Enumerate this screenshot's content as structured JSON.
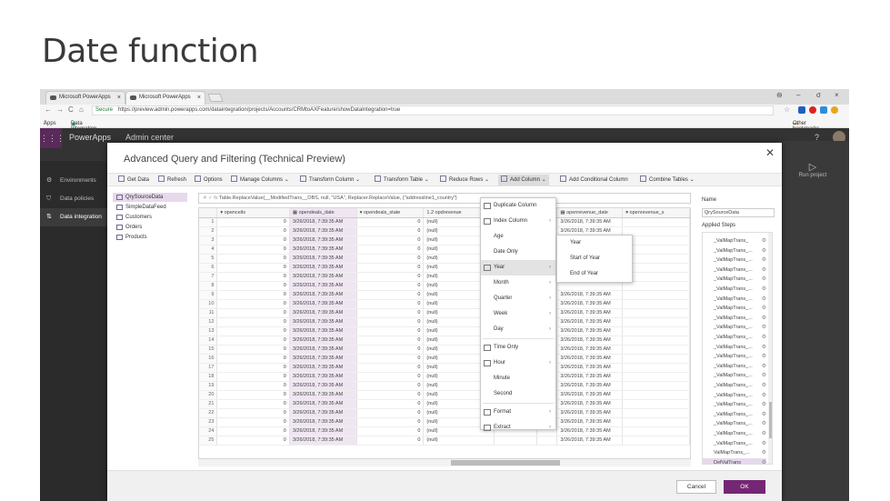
{
  "slide_title": "Date function",
  "browser": {
    "tabs": [
      {
        "label": "Microsoft PowerApps"
      },
      {
        "label": "Microsoft PowerApps"
      }
    ],
    "url_secure": "Secure",
    "url": "https://preview.admin.powerapps.com/dataintegration/projects/Accounts/CRMtoAXFeature/showDataIntegration=true",
    "bookmarks": {
      "apps": "Apps",
      "item": "Data Integration Lab",
      "other": "Other bookmarks"
    }
  },
  "app": {
    "name": "PowerApps",
    "admin": "Admin center",
    "nav": [
      {
        "label": "Environments",
        "icon": "globe-icon"
      },
      {
        "label": "Data policies",
        "icon": "shield-icon"
      },
      {
        "label": "Data integration",
        "icon": "flow-icon"
      }
    ],
    "run_project": "Run project"
  },
  "dialog": {
    "title": "Advanced Query and Filtering (Technical Preview)",
    "ribbon": [
      "Get Data",
      "Refresh",
      "Options",
      "Manage Columns",
      "Transform Column",
      "Transform Table",
      "Reduce Rows",
      "Add Column",
      "Add Conditional Column",
      "Combine Tables"
    ],
    "queries": [
      "QrySourceData",
      "SimpleDataFeed",
      "Customers",
      "Orders",
      "Products"
    ],
    "formula": "Table.ReplaceValue(__ModifiedTrans__OBS, null, \"USA\", Replacer.ReplaceValue, {\"addressline1_country\"}",
    "columns": [
      "openceils",
      "opendeals_date",
      "opendeals_state",
      "opdrevenue",
      "",
      "base",
      "openrevenue_date",
      "openrevenue_s"
    ],
    "rows": [
      {
        "n": "1",
        "a": "0",
        "d": "3/26/2018, 7:39:35 AM",
        "s": "0",
        "v": "(null)",
        "r": "3/26/2018, 7:39:35 AM"
      },
      {
        "n": "2",
        "a": "0",
        "d": "3/26/2018, 7:39:35 AM",
        "s": "0",
        "v": "(null)",
        "r": "3/26/2018, 7:39:35 AM"
      },
      {
        "n": "3",
        "a": "0",
        "d": "3/26/2018, 7:39:35 AM",
        "s": "0",
        "v": "(null)",
        "r": "3/26/2018, 7:39:35 AM"
      },
      {
        "n": "4",
        "a": "0",
        "d": "3/26/2018, 7:39:35 AM",
        "s": "0",
        "v": "(null)",
        "r": ""
      },
      {
        "n": "5",
        "a": "0",
        "d": "3/26/2018, 7:39:35 AM",
        "s": "0",
        "v": "(null)",
        "r": ""
      },
      {
        "n": "6",
        "a": "0",
        "d": "3/26/2018, 7:39:35 AM",
        "s": "0",
        "v": "(null)",
        "r": ""
      },
      {
        "n": "7",
        "a": "0",
        "d": "3/26/2018, 7:39:35 AM",
        "s": "0",
        "v": "(null)",
        "r": ""
      },
      {
        "n": "8",
        "a": "0",
        "d": "3/26/2018, 7:39:35 AM",
        "s": "0",
        "v": "(null)",
        "r": ""
      },
      {
        "n": "9",
        "a": "0",
        "d": "3/26/2018, 7:39:35 AM",
        "s": "0",
        "v": "(null)",
        "r": "3/26/2018, 7:39:35 AM"
      },
      {
        "n": "10",
        "a": "0",
        "d": "3/26/2018, 7:39:35 AM",
        "s": "0",
        "v": "(null)",
        "r": "3/26/2018, 7:39:35 AM"
      },
      {
        "n": "11",
        "a": "0",
        "d": "3/26/2018, 7:39:35 AM",
        "s": "0",
        "v": "(null)",
        "r": "3/26/2018, 7:39:35 AM"
      },
      {
        "n": "12",
        "a": "0",
        "d": "3/26/2018, 7:39:35 AM",
        "s": "0",
        "v": "(null)",
        "r": "3/26/2018, 7:39:35 AM"
      },
      {
        "n": "13",
        "a": "0",
        "d": "3/26/2018, 7:39:35 AM",
        "s": "0",
        "v": "(null)",
        "r": "3/26/2018, 7:39:35 AM"
      },
      {
        "n": "14",
        "a": "0",
        "d": "3/26/2018, 7:39:35 AM",
        "s": "0",
        "v": "(null)",
        "r": "3/26/2018, 7:39:35 AM"
      },
      {
        "n": "15",
        "a": "0",
        "d": "3/26/2018, 7:39:35 AM",
        "s": "0",
        "v": "(null)",
        "r": "3/26/2018, 7:39:35 AM"
      },
      {
        "n": "16",
        "a": "0",
        "d": "3/26/2018, 7:39:35 AM",
        "s": "0",
        "v": "(null)",
        "r": "3/26/2018, 7:39:35 AM"
      },
      {
        "n": "17",
        "a": "0",
        "d": "3/26/2018, 7:39:35 AM",
        "s": "0",
        "v": "(null)",
        "r": "3/26/2018, 7:39:35 AM"
      },
      {
        "n": "18",
        "a": "0",
        "d": "3/26/2018, 7:39:35 AM",
        "s": "0",
        "v": "(null)",
        "r": "3/26/2018, 7:39:35 AM"
      },
      {
        "n": "19",
        "a": "0",
        "d": "3/26/2018, 7:39:35 AM",
        "s": "0",
        "v": "(null)",
        "r": "3/26/2018, 7:39:35 AM"
      },
      {
        "n": "20",
        "a": "0",
        "d": "3/26/2018, 7:39:35 AM",
        "s": "0",
        "v": "(null)",
        "r": "3/26/2018, 7:39:35 AM"
      },
      {
        "n": "21",
        "a": "0",
        "d": "3/26/2018, 7:39:35 AM",
        "s": "0",
        "v": "(null)",
        "r": "3/26/2018, 7:39:35 AM"
      },
      {
        "n": "22",
        "a": "0",
        "d": "3/26/2018, 7:39:35 AM",
        "s": "0",
        "v": "(null)",
        "r": "3/26/2018, 7:39:35 AM"
      },
      {
        "n": "23",
        "a": "0",
        "d": "3/26/2018, 7:39:35 AM",
        "s": "0",
        "v": "(null)",
        "r": "3/26/2018, 7:39:35 AM"
      },
      {
        "n": "24",
        "a": "0",
        "d": "3/26/2018, 7:39:35 AM",
        "s": "0",
        "v": "(null)",
        "r": "3/26/2018, 7:39:35 AM"
      },
      {
        "n": "25",
        "a": "0",
        "d": "3/26/2018, 7:39:35 AM",
        "s": "0",
        "v": "(null)",
        "r": "3/26/2018, 7:39:35 AM"
      }
    ],
    "menu": [
      {
        "label": "Duplicate Column",
        "arrow": ""
      },
      {
        "label": "Index Column",
        "arrow": "›"
      },
      {
        "label": "Age",
        "arrow": ""
      },
      {
        "label": "Date Only",
        "arrow": ""
      },
      {
        "label": "Year",
        "arrow": "›"
      },
      {
        "label": "Month",
        "arrow": "›"
      },
      {
        "label": "Quarter",
        "arrow": "›"
      },
      {
        "label": "Week",
        "arrow": "›"
      },
      {
        "label": "Day",
        "arrow": "›"
      },
      {
        "label": "Time Only",
        "arrow": ""
      },
      {
        "label": "Hour",
        "arrow": "›"
      },
      {
        "label": "Minute",
        "arrow": ""
      },
      {
        "label": "Second",
        "arrow": ""
      },
      {
        "label": "Format",
        "arrow": "›"
      },
      {
        "label": "Extract",
        "arrow": "›"
      }
    ],
    "submenu": [
      "Year",
      "Start of Year",
      "End of Year"
    ],
    "settings": {
      "name_label": "Name",
      "name_value": "QrySourceData",
      "steps_label": "Applied Steps"
    },
    "steps": [
      "_ValMapTrans_",
      "_ValMapTrans_...",
      "_ValMapTrans_...",
      "_ValMapTrans_...",
      "_ValMapTrans_...",
      "_ValMapTrans_...",
      "_ValMapTrans_...",
      "_ValMapTrans_...",
      "_ValMapTrans_...",
      "_ValMapTrans_...",
      "_ValMapTrans_...",
      "_ValMapTrans_...",
      "_ValMapTrans_...",
      "_ValMapTrans_...",
      "_ValMapTrans_...",
      "_ValMapTrans_...",
      "_ValMapTrans_...",
      "_ValMapTrans_...",
      "_ValMapTrans_...",
      "_ValMapTrans_...",
      "_ValMapTrans_...",
      "_ValMapTrans_...",
      "ValMapTrans_...",
      "DefValTrans"
    ],
    "cancel": "Cancel",
    "ok": "OK"
  }
}
